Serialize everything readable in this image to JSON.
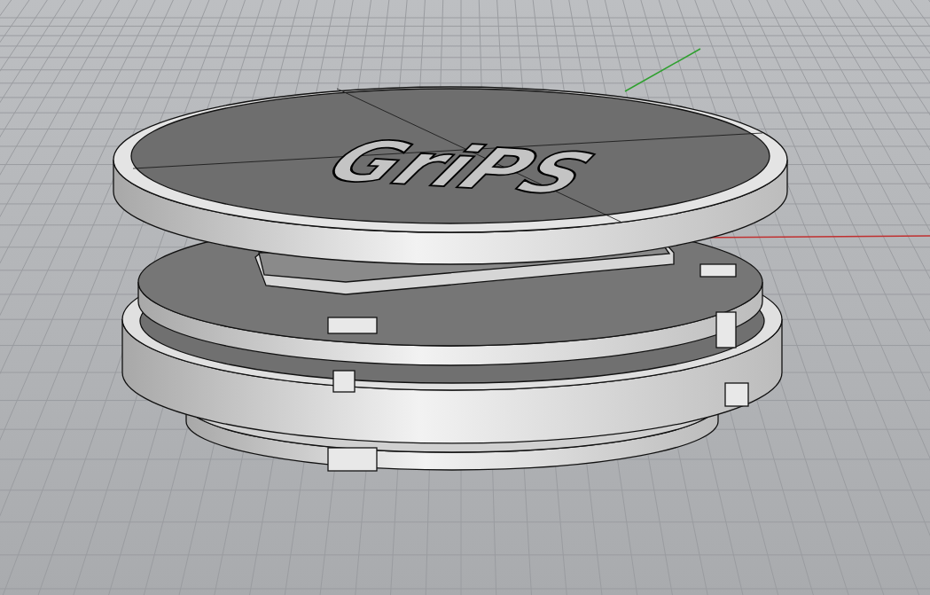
{
  "viewport": {
    "model_label": "GriPS"
  }
}
